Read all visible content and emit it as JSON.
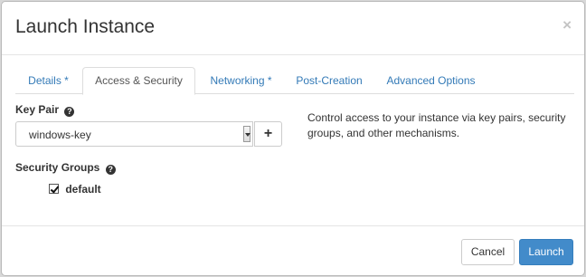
{
  "header": {
    "title": "Launch Instance",
    "close": "×"
  },
  "tabs": [
    {
      "label": "Details *",
      "active": false
    },
    {
      "label": "Access & Security",
      "active": true
    },
    {
      "label": "Networking *",
      "active": false
    },
    {
      "label": "Post-Creation",
      "active": false
    },
    {
      "label": "Advanced Options",
      "active": false
    }
  ],
  "keypair": {
    "label": "Key Pair",
    "help": "?",
    "value": "windows-key",
    "add": "+"
  },
  "security_groups": {
    "label": "Security Groups",
    "help": "?",
    "items": [
      {
        "label": "default",
        "checked": true
      }
    ]
  },
  "description": "Control access to your instance via key pairs, security groups, and other mechanisms.",
  "footer": {
    "cancel": "Cancel",
    "launch": "Launch"
  },
  "colors": {
    "link": "#337ab7",
    "primary": "#428bca"
  }
}
